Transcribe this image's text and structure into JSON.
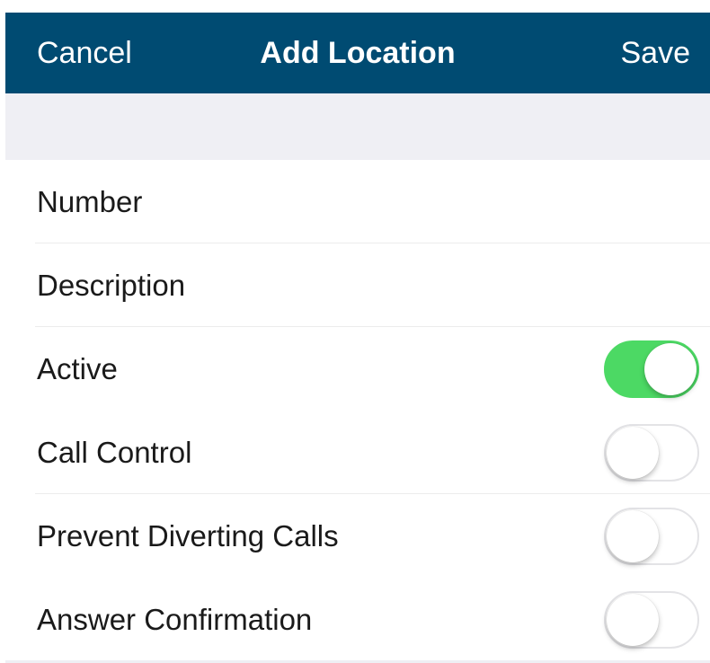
{
  "navbar": {
    "cancel_label": "Cancel",
    "title": "Add Location",
    "save_label": "Save",
    "background_color": "#004b72"
  },
  "form": {
    "rows": [
      {
        "label": "Number",
        "type": "text-field"
      },
      {
        "label": "Description",
        "type": "text-field"
      },
      {
        "label": "Active",
        "type": "switch",
        "on": true
      },
      {
        "label": "Call Control",
        "type": "switch",
        "on": false
      },
      {
        "label": "Prevent Diverting Calls",
        "type": "switch",
        "on": false
      },
      {
        "label": "Answer Confirmation",
        "type": "switch",
        "on": false
      }
    ]
  },
  "colors": {
    "switch_on": "#4cd964",
    "section_background": "#efeff4"
  }
}
